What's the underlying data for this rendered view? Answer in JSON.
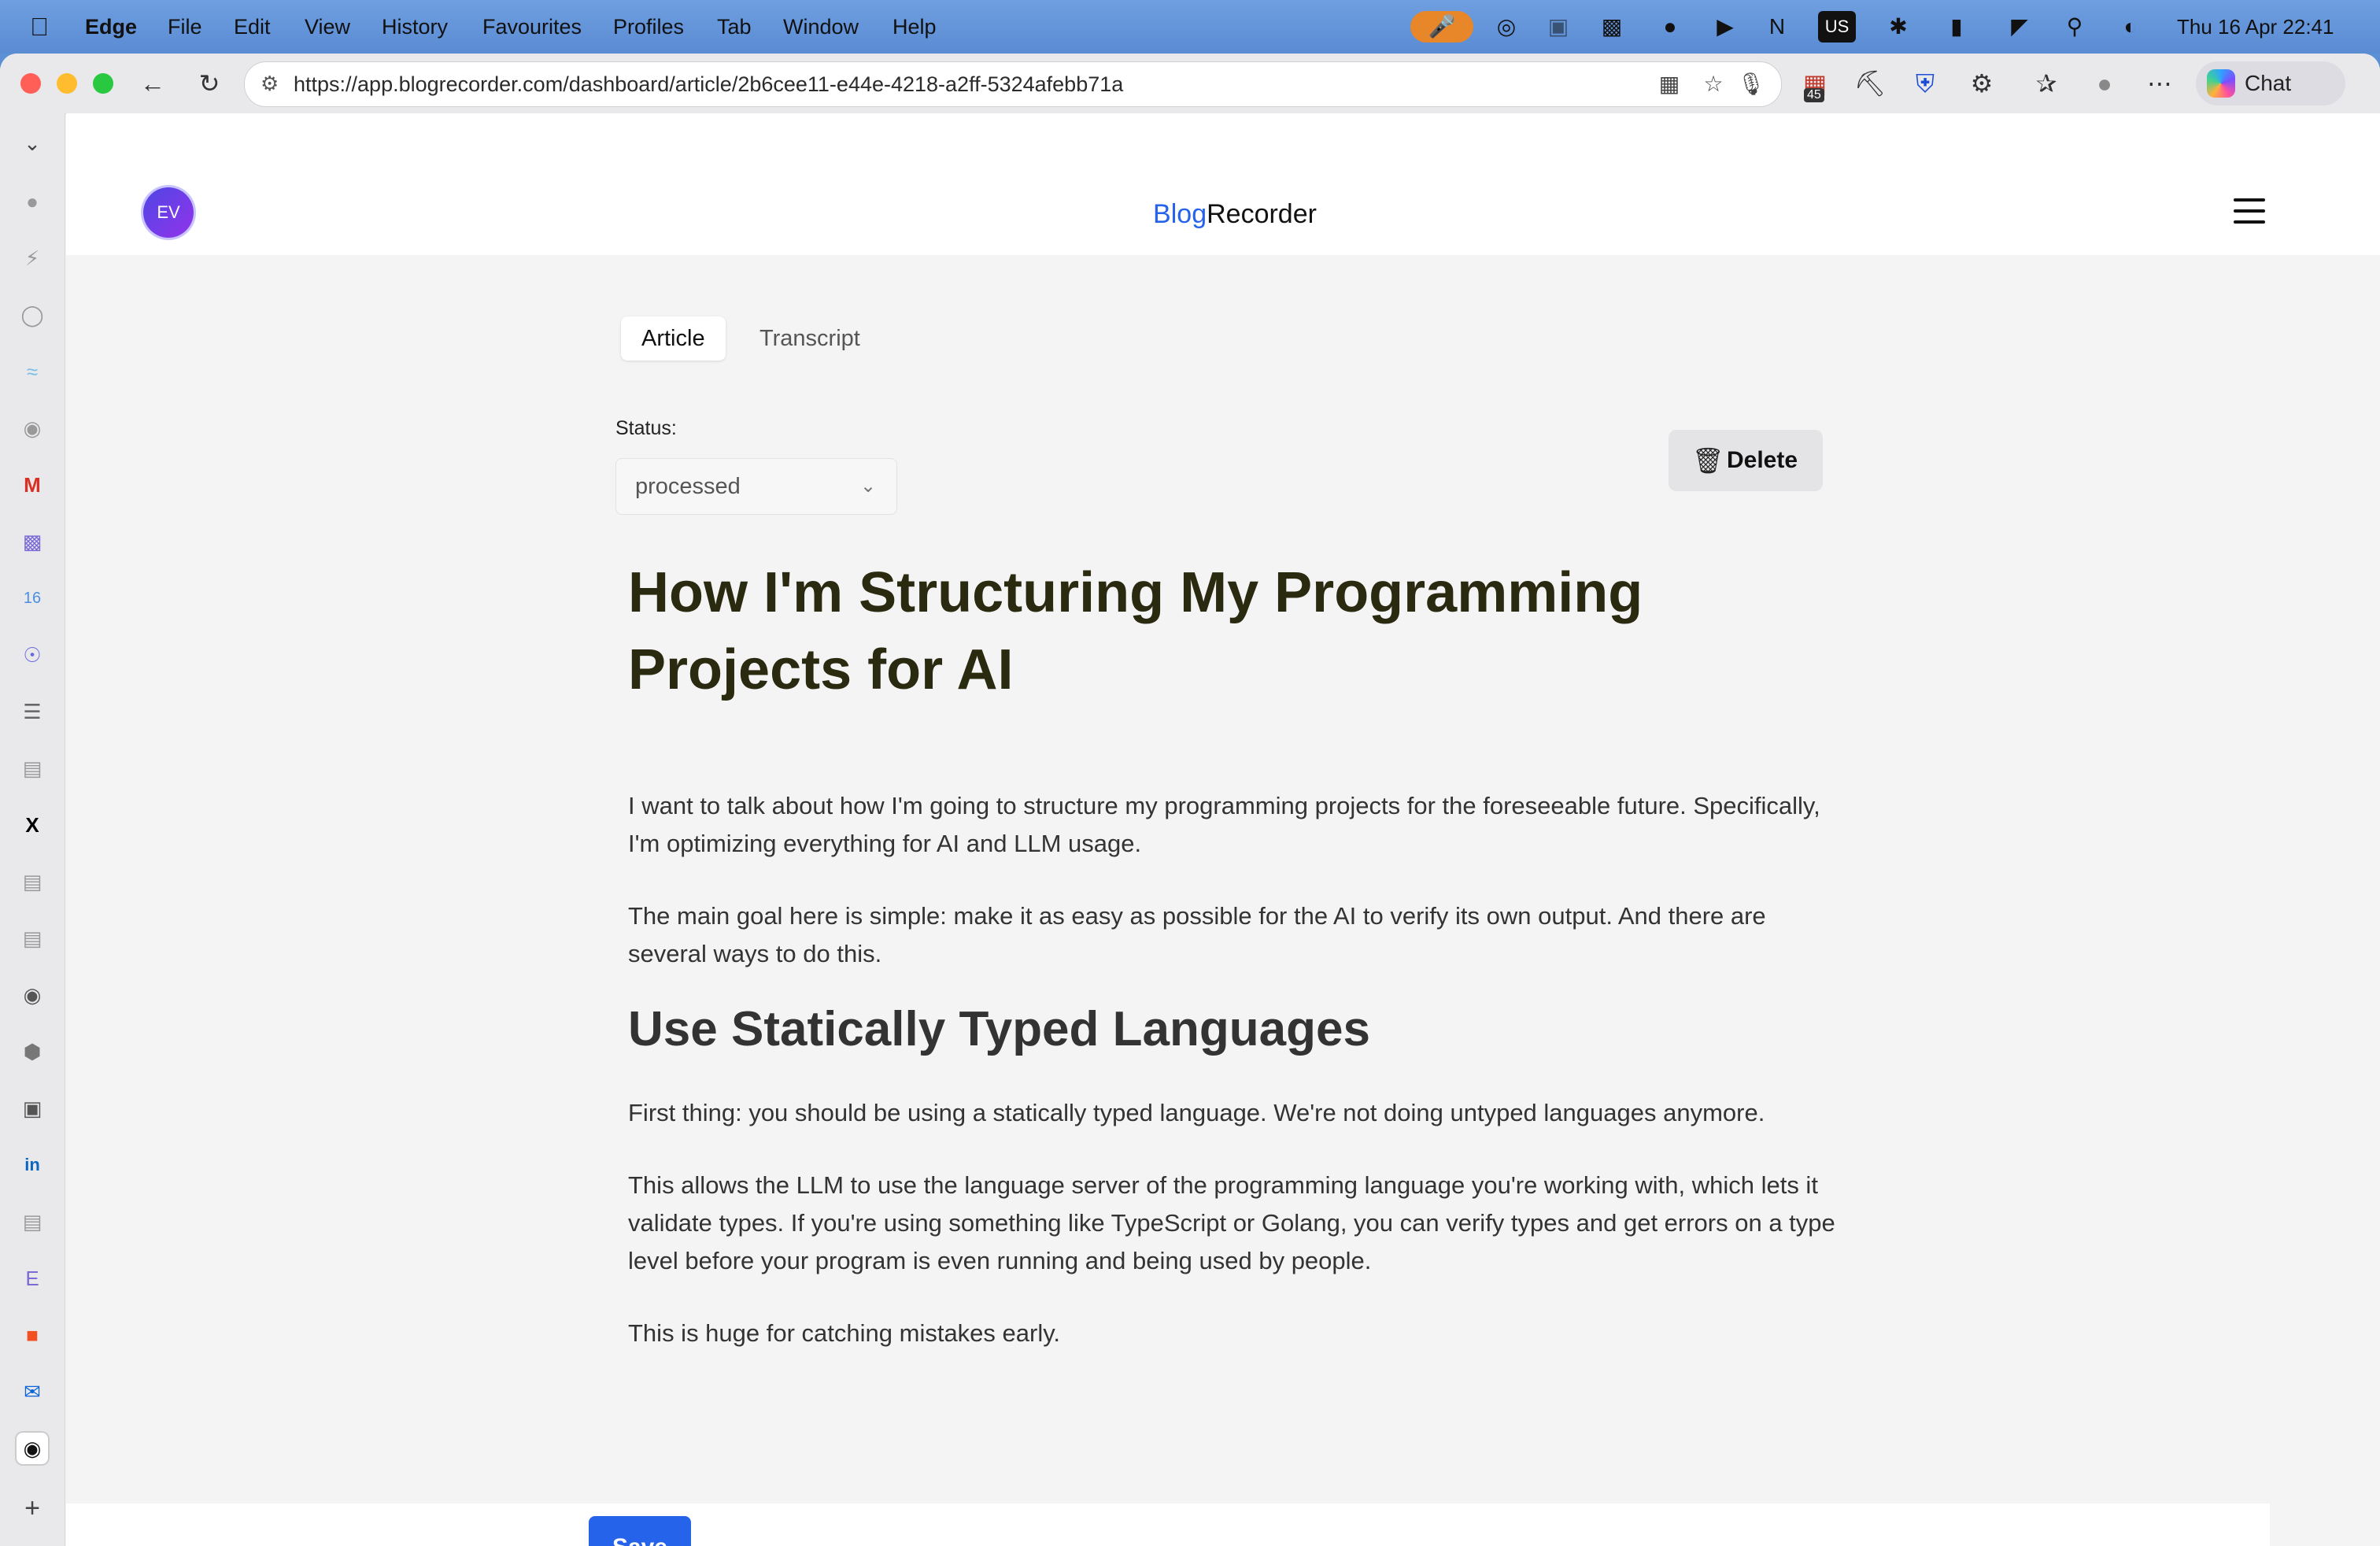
{
  "menubar": {
    "app_name": "Edge",
    "items": [
      "File",
      "Edit",
      "View",
      "History",
      "Favourites",
      "Profiles",
      "Tab",
      "Window",
      "Help"
    ],
    "clock": "Thu 16 Apr  22:41",
    "keyboard": "US"
  },
  "browser": {
    "url": "https://app.blogrecorder.com/dashboard/article/2b6cee11-e44e-4218-a2ff-5324afebb71a",
    "chat_label": "Chat",
    "badge_count": "45"
  },
  "app": {
    "avatar_initials": "EV",
    "brand_part1": "Blog",
    "brand_part2": "Recorder"
  },
  "tabs": [
    {
      "label": "Article",
      "active": true
    },
    {
      "label": "Transcript",
      "active": false
    }
  ],
  "status": {
    "label": "Status:",
    "value": "processed"
  },
  "delete_label": "Delete",
  "save_label": "Save",
  "article": {
    "title": "How I'm Structuring My Programming Projects for AI",
    "paragraphs": [
      "I want to talk about how I'm going to structure my programming projects for the foreseeable future. Specifically, I'm optimizing everything for AI and LLM usage.",
      "The main goal here is simple: make it as easy as possible for the AI to verify its own output. And there are several ways to do this."
    ],
    "section_title": "Use Statically Typed Languages",
    "section_paragraphs": [
      "First thing: you should be using a statically typed language. We're not doing untyped languages anymore.",
      "This allows the LLM to use the language server of the programming language you're working with, which lets it validate types. If you're using something like TypeScript or Golang, you can verify types and get errors on a type level before your program is even running and being used by people.",
      "This is huge for catching mistakes early."
    ]
  }
}
